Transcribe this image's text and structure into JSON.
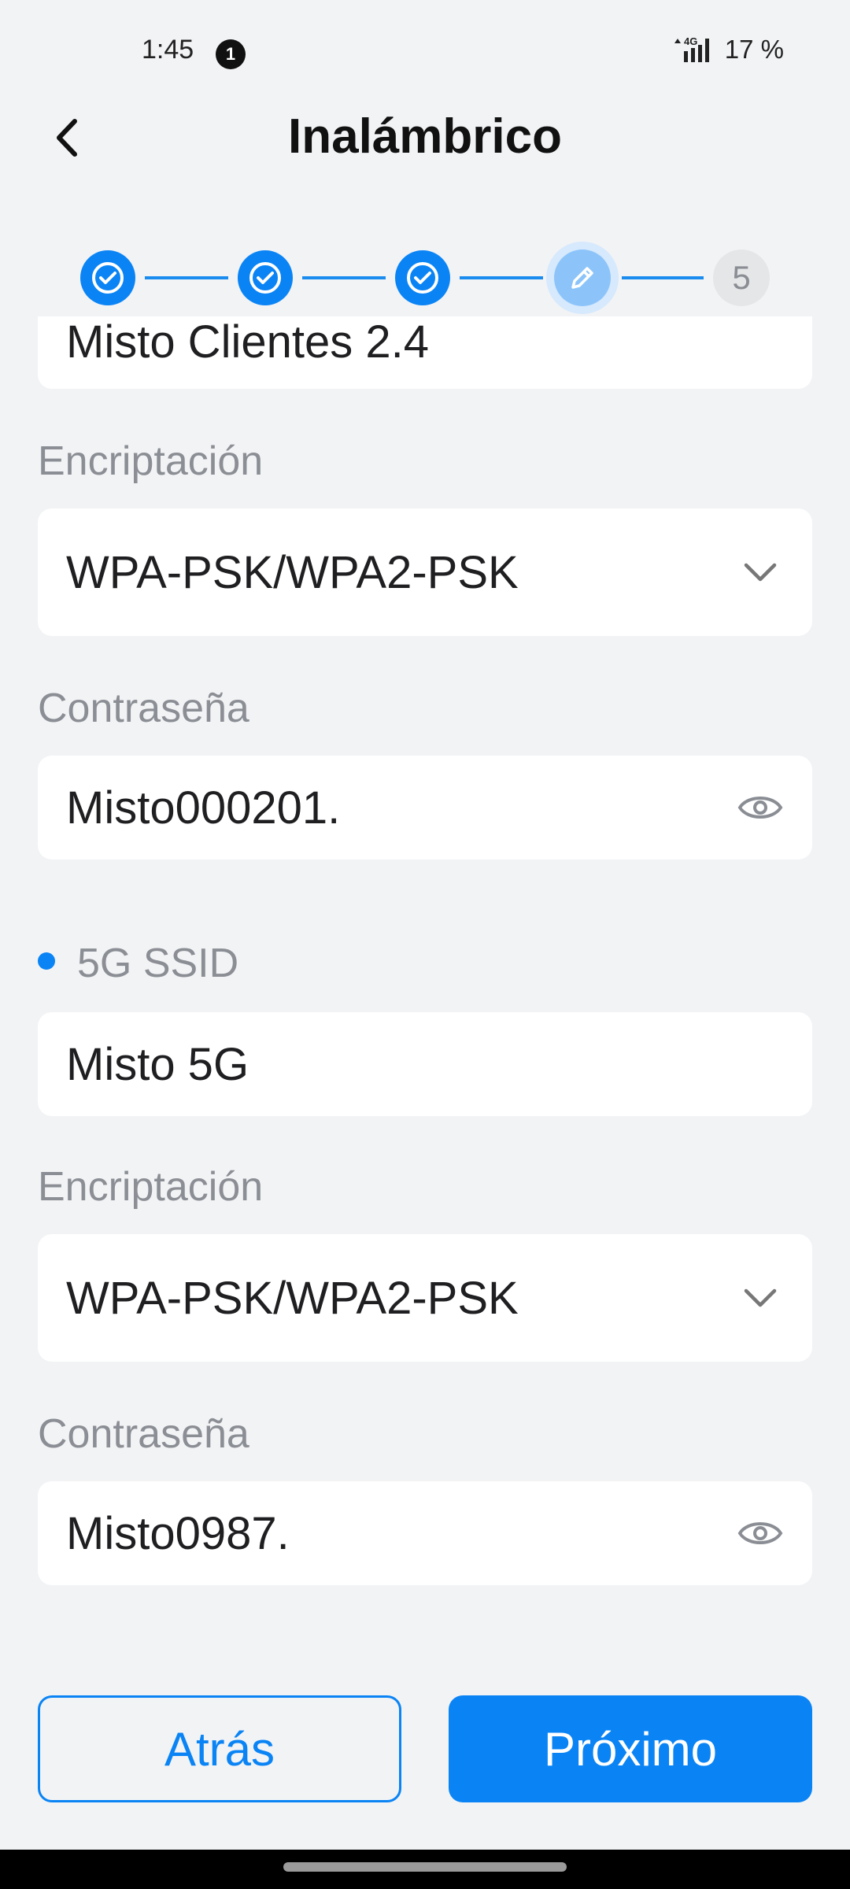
{
  "status_bar": {
    "time": "1:45",
    "notification_count": "1",
    "network": "4G",
    "battery": "17 %"
  },
  "header": {
    "title": "Inalámbrico"
  },
  "stepper": {
    "current_step": 4,
    "pending_label": "5",
    "accent": "#0a84f5"
  },
  "band_24": {
    "ssid_value": "Misto Clientes 2.4",
    "encryption_label": "Encriptación",
    "encryption_value": "WPA-PSK/WPA2-PSK",
    "password_label": "Contraseña",
    "password_value": "Misto000201."
  },
  "band_5g": {
    "section_label": "5G SSID",
    "ssid_value": "Misto 5G",
    "encryption_label": "Encriptación",
    "encryption_value": "WPA-PSK/WPA2-PSK",
    "password_label": "Contraseña",
    "password_value": "Misto0987."
  },
  "buttons": {
    "back_label": "Atrás",
    "next_label": "Próximo"
  },
  "icons": {
    "back": "chevron-left-icon",
    "dropdown": "chevron-down-icon",
    "reveal": "eye-icon",
    "step_done": "check-circle-icon",
    "step_current": "pencil-icon"
  }
}
